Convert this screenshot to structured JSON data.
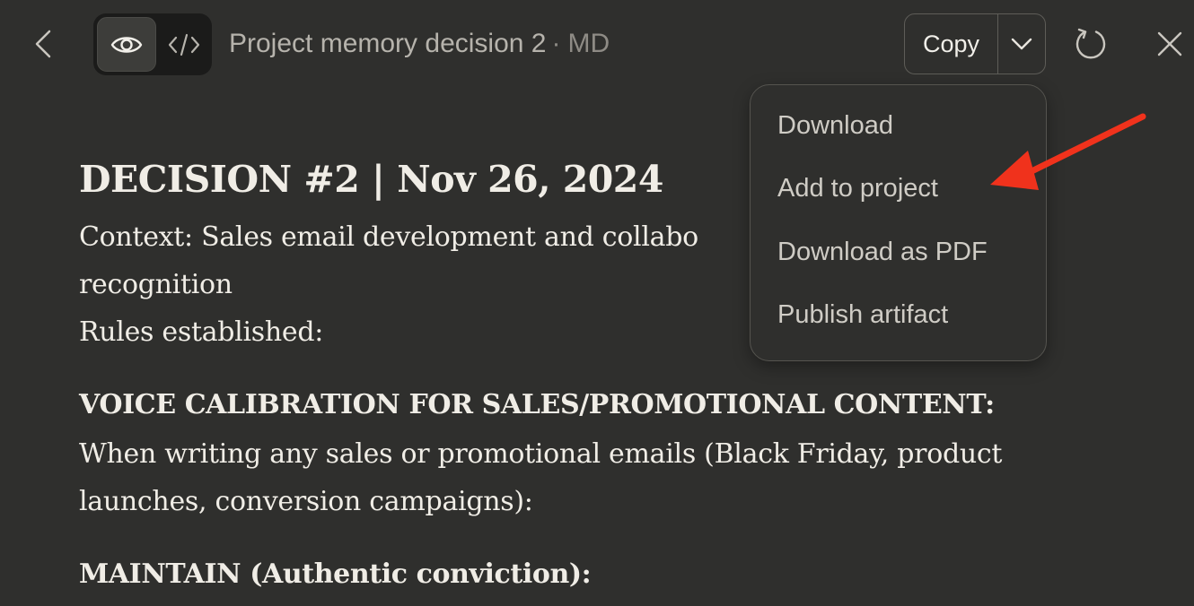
{
  "header": {
    "title": "Project memory decision 2",
    "separator": "·",
    "file_type": "MD",
    "copy_label": "Copy",
    "icons": {
      "back": "chevron-left-icon",
      "preview": "eye-icon",
      "code": "code-icon",
      "dropdown": "chevron-down-icon",
      "refresh": "refresh-icon",
      "close": "close-icon"
    }
  },
  "dropdown": {
    "items": [
      {
        "label": "Download"
      },
      {
        "label": "Add to project"
      },
      {
        "label": "Download as PDF"
      },
      {
        "label": "Publish artifact"
      }
    ]
  },
  "document": {
    "heading": "DECISION #2 | Nov 26, 2024",
    "context_line1": "Context: Sales email development and collabo",
    "context_line2": "recognition",
    "rules_label": "Rules established:",
    "section1_heading": "VOICE CALIBRATION FOR SALES/PROMOTIONAL CONTENT:",
    "section1_line1": "When writing any sales or promotional emails (Black Friday, product",
    "section1_line2": "launches, conversion campaigns):",
    "section2_heading": "MAINTAIN (Authentic conviction):"
  },
  "colors": {
    "background": "#2f2f2d",
    "annotation_arrow": "#f0321c"
  }
}
